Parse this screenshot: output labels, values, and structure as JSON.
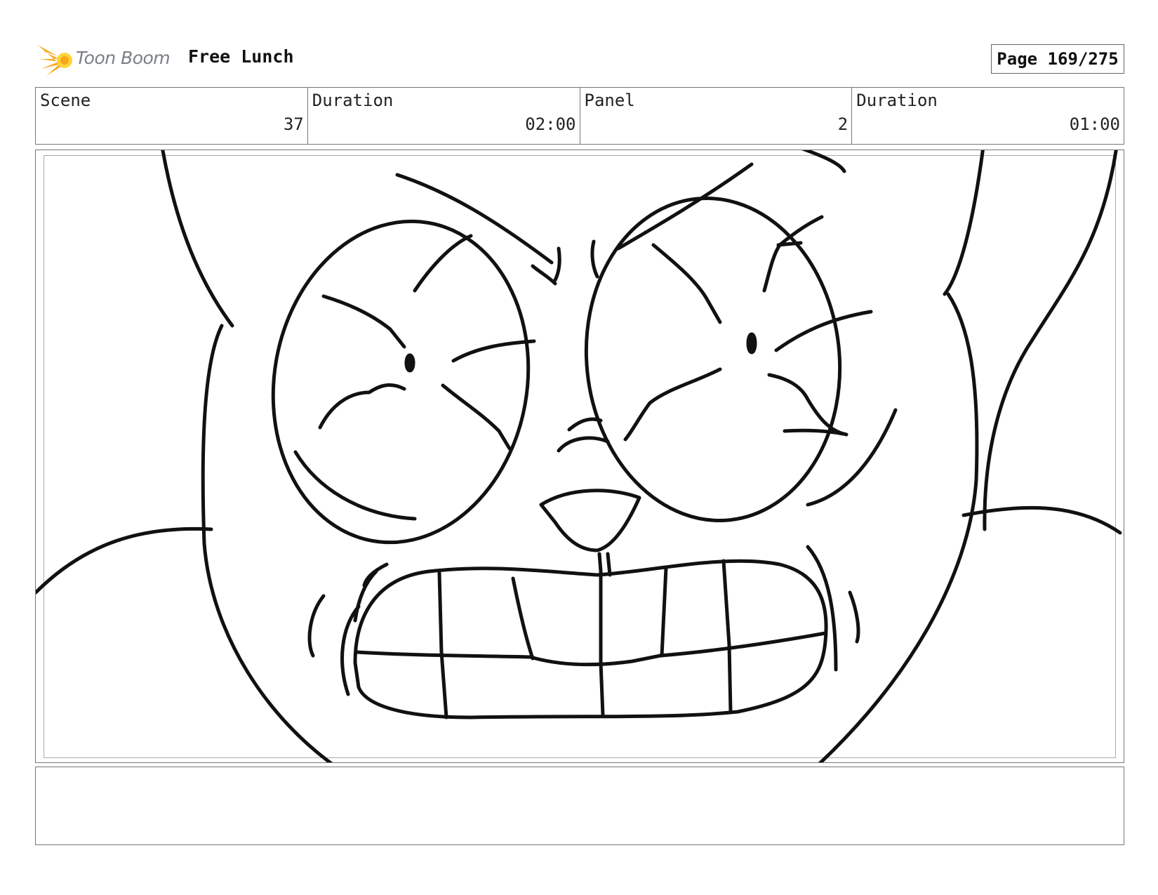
{
  "header": {
    "logo_text": "Toon Boom",
    "project_title": "Free Lunch",
    "page_label": "Page 169/275"
  },
  "info": {
    "scene_label": "Scene",
    "scene_value": "37",
    "scene_duration_label": "Duration",
    "scene_duration_value": "02:00",
    "panel_label": "Panel",
    "panel_value": "2",
    "panel_duration_label": "Duration",
    "panel_duration_value": "01:00"
  },
  "caption": {
    "text": ""
  },
  "colors": {
    "logo_orange": "#f6a81a",
    "logo_yellow": "#ffd43b",
    "logo_gray": "#7a7f86",
    "frame_border": "#777777",
    "ink": "#111111"
  }
}
